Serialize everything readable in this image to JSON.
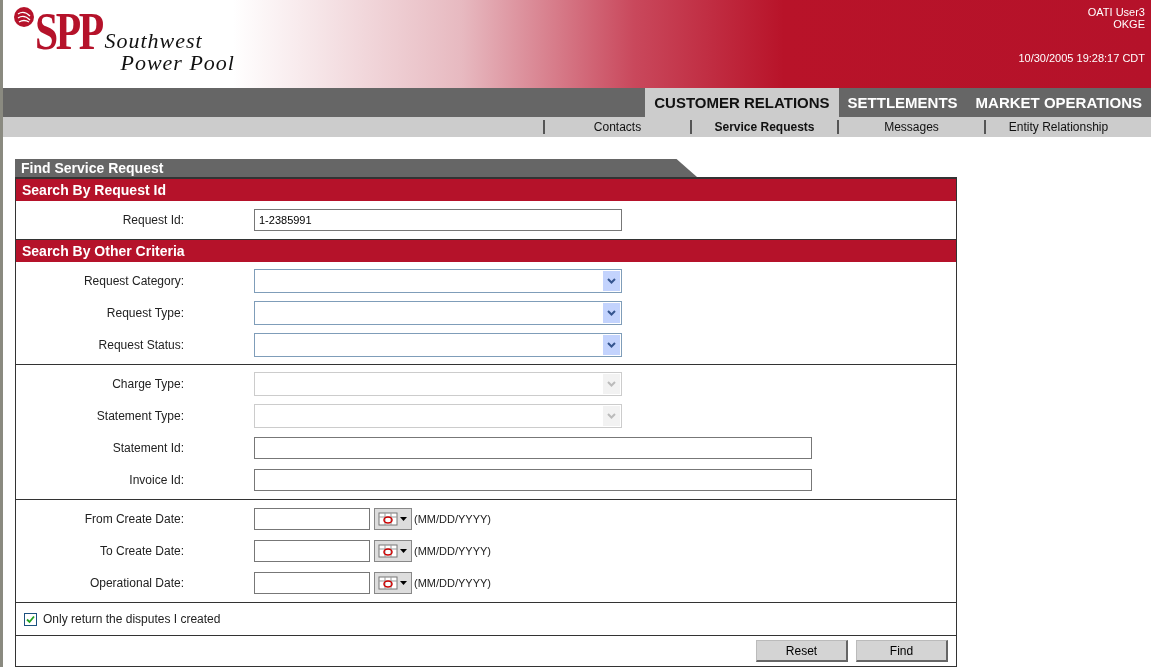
{
  "logo": {
    "mark": "SPP",
    "line1": "Southwest",
    "line2": "Power Pool"
  },
  "user": {
    "name": "OATI User3",
    "company": "OKGE",
    "datetime": "10/30/2005 19:28:17 CDT"
  },
  "main_tabs": [
    {
      "label": "CUSTOMER RELATIONS",
      "selected": true
    },
    {
      "label": "SETTLEMENTS",
      "selected": false
    },
    {
      "label": "MARKET OPERATIONS",
      "selected": false
    }
  ],
  "sub_tabs": [
    {
      "label": "Contacts",
      "selected": false
    },
    {
      "label": "Service Requests",
      "selected": true
    },
    {
      "label": "Messages",
      "selected": false
    },
    {
      "label": "Entity Relationship",
      "selected": false
    }
  ],
  "panel": {
    "title": "Find Service Request",
    "sections": [
      {
        "title": "Search By Request Id",
        "groups": [
          [
            {
              "label": "Request Id:",
              "kind": "text",
              "value": "1-2385991"
            }
          ]
        ]
      },
      {
        "title": "Search By Other Criteria",
        "groups": [
          [
            {
              "label": "Request Category:",
              "kind": "select",
              "disabled": false
            },
            {
              "label": "Request Type:",
              "kind": "select",
              "disabled": false
            },
            {
              "label": "Request Status:",
              "kind": "select",
              "disabled": false
            }
          ],
          [
            {
              "label": "Charge Type:",
              "kind": "select",
              "disabled": true
            },
            {
              "label": "Statement Type:",
              "kind": "select",
              "disabled": true
            },
            {
              "label": "Statement Id:",
              "kind": "text"
            },
            {
              "label": "Invoice Id:",
              "kind": "text"
            }
          ],
          [
            {
              "label": "From Create Date:",
              "kind": "date",
              "hint": "(MM/DD/YYYY)"
            },
            {
              "label": "To Create Date:",
              "kind": "date",
              "hint": "(MM/DD/YYYY)"
            },
            {
              "label": "Operational Date:",
              "kind": "date",
              "hint": "(MM/DD/YYYY)"
            }
          ]
        ]
      }
    ],
    "checkbox": {
      "label": "Only return the disputes I created",
      "checked": true
    },
    "buttons": [
      "Reset",
      "Find"
    ]
  }
}
